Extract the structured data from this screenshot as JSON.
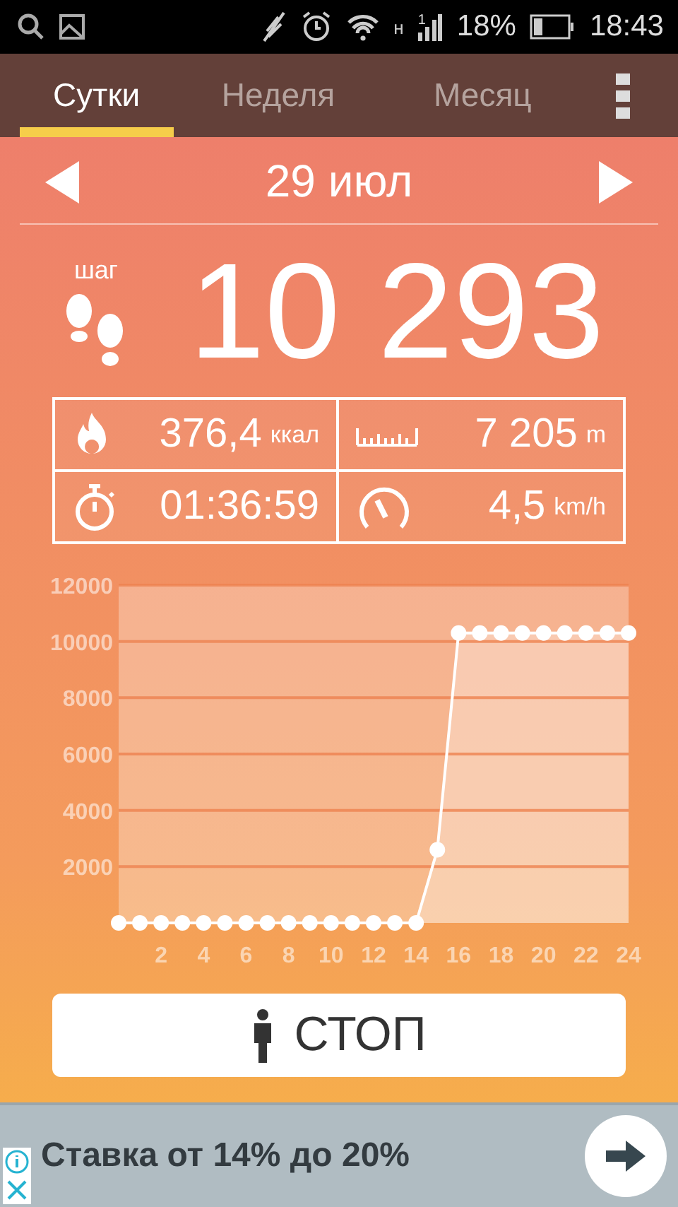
{
  "status_bar": {
    "network_letter": "н",
    "sim_number": "1",
    "battery_percent": "18%",
    "time": "18:43"
  },
  "tabs": [
    {
      "label": "Сутки",
      "selected": true
    },
    {
      "label": "Неделя",
      "selected": false
    },
    {
      "label": "Месяц",
      "selected": false
    }
  ],
  "date": "29 июл",
  "steps": {
    "label": "шаг",
    "value": "10 293"
  },
  "stats": [
    {
      "kind": "calories",
      "value": "376,4",
      "unit": "ккал"
    },
    {
      "kind": "distance",
      "value": "7 205",
      "unit": "m"
    },
    {
      "kind": "time",
      "value": "01:36:59"
    },
    {
      "kind": "speed",
      "value": "4,5",
      "unit": "km/h"
    }
  ],
  "chart": {
    "chart_data": {
      "type": "area",
      "x": [
        0,
        1,
        2,
        3,
        4,
        5,
        6,
        7,
        8,
        9,
        10,
        11,
        12,
        13,
        14,
        15,
        16,
        17,
        18,
        19,
        20,
        21,
        22,
        23,
        24
      ],
      "series": [
        {
          "values": [
            0,
            0,
            0,
            0,
            0,
            0,
            0,
            0,
            0,
            0,
            0,
            0,
            0,
            0,
            0,
            2600,
            10300,
            10300,
            10300,
            10300,
            10300,
            10300,
            10300,
            10300,
            10300
          ]
        }
      ],
      "grid": true,
      "xlim": [
        0,
        24
      ],
      "ylim": [
        0,
        12000
      ],
      "xticks": [
        2,
        4,
        6,
        8,
        10,
        12,
        14,
        16,
        18,
        20,
        22,
        24
      ],
      "yticks": [
        2000,
        4000,
        6000,
        8000,
        10000,
        12000
      ]
    }
  },
  "stop_button": {
    "label": "СТОП"
  },
  "ad": {
    "text": "Ставка от 14% до 20%"
  }
}
